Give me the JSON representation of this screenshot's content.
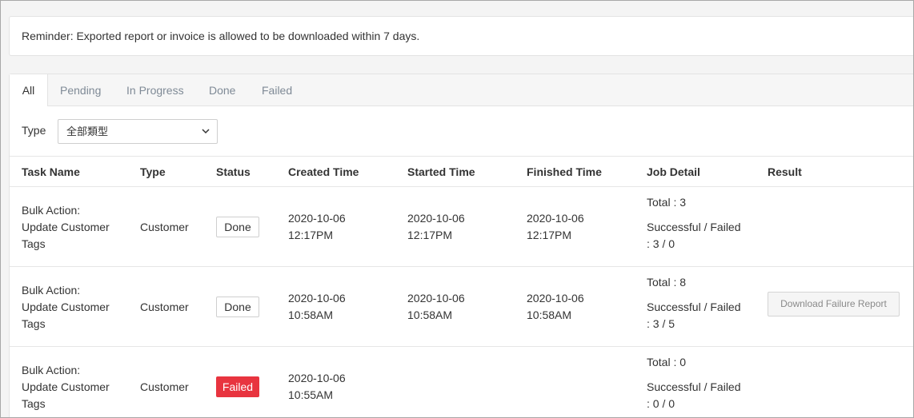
{
  "reminder": "Reminder: Exported report or invoice is allowed to be downloaded within 7 days.",
  "tabs": [
    "All",
    "Pending",
    "In Progress",
    "Done",
    "Failed"
  ],
  "active_tab": "All",
  "filter": {
    "label": "Type",
    "value": "全部類型"
  },
  "columns": [
    "Task Name",
    "Type",
    "Status",
    "Created Time",
    "Started Time",
    "Finished Time",
    "Job Detail",
    "Result"
  ],
  "rows": [
    {
      "task_line1": "Bulk Action:",
      "task_line2": "Update Customer",
      "task_line3": "Tags",
      "type": "Customer",
      "status": "Done",
      "created_date": "2020-10-06",
      "created_time": "12:17PM",
      "started_date": "2020-10-06",
      "started_time": "12:17PM",
      "finished_date": "2020-10-06",
      "finished_time": "12:17PM",
      "total": "Total : 3",
      "sf_label": "Successful / Failed",
      "sf_value": ": 3 / 0",
      "result": ""
    },
    {
      "task_line1": "Bulk Action:",
      "task_line2": "Update Customer",
      "task_line3": "Tags",
      "type": "Customer",
      "status": "Done",
      "created_date": "2020-10-06",
      "created_time": "10:58AM",
      "started_date": "2020-10-06",
      "started_time": "10:58AM",
      "finished_date": "2020-10-06",
      "finished_time": "10:58AM",
      "total": "Total : 8",
      "sf_label": "Successful / Failed",
      "sf_value": ": 3 / 5",
      "result": "Download Failure Report"
    },
    {
      "task_line1": "Bulk Action:",
      "task_line2": "Update Customer",
      "task_line3": "Tags",
      "type": "Customer",
      "status": "Failed",
      "created_date": "2020-10-06",
      "created_time": "10:55AM",
      "started_date": "",
      "started_time": "",
      "finished_date": "",
      "finished_time": "",
      "total": "Total : 0",
      "sf_label": "Successful / Failed",
      "sf_value": ": 0 / 0",
      "result": ""
    }
  ],
  "colors": {
    "failed_badge": "#e8343f",
    "tab_inactive": "#7f8a96"
  },
  "icons": {
    "select_caret": "chevron-down-icon"
  }
}
